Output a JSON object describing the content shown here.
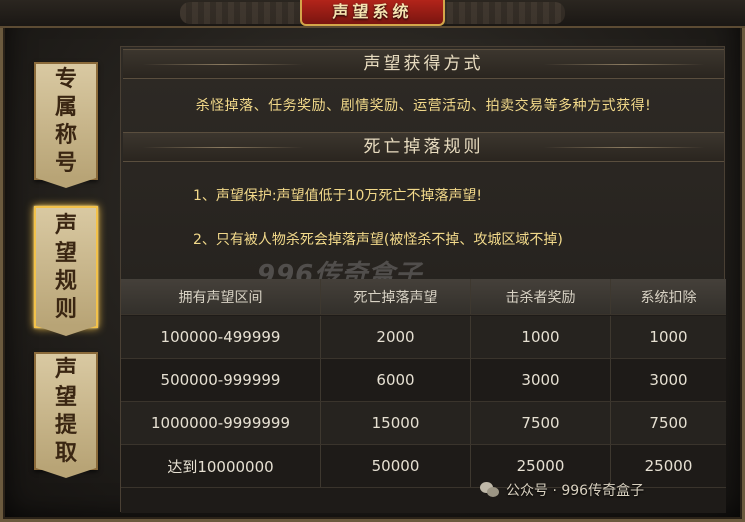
{
  "window": {
    "title": "声望系统"
  },
  "tabs": [
    {
      "label": "专属称号",
      "lines": [
        "专",
        "属",
        "称",
        "号"
      ],
      "active": false
    },
    {
      "label": "声望规则",
      "lines": [
        "声",
        "望",
        "规",
        "则"
      ],
      "active": true
    },
    {
      "label": "声望提取",
      "lines": [
        "声",
        "望",
        "提",
        "取"
      ],
      "active": false
    }
  ],
  "methods": {
    "header": "声望获得方式",
    "text": "杀怪掉落、任务奖励、剧情奖励、运营活动、拍卖交易等多种方式获得!"
  },
  "rules": {
    "header": "死亡掉落规则",
    "items": [
      "1、声望保护:声望值低于10万死亡不掉落声望!",
      "2、只有被人物杀死会掉落声望(被怪杀不掉、攻城区域不掉)"
    ]
  },
  "watermark": "996传奇盒子",
  "table": {
    "headers": [
      "拥有声望区间",
      "死亡掉落声望",
      "击杀者奖励",
      "系统扣除"
    ],
    "rows": [
      [
        "100000-499999",
        "2000",
        "1000",
        "1000"
      ],
      [
        "500000-999999",
        "6000",
        "3000",
        "3000"
      ],
      [
        "1000000-9999999",
        "15000",
        "7500",
        "7500"
      ],
      [
        "达到10000000",
        "50000",
        "25000",
        "25000"
      ]
    ]
  },
  "footer": {
    "text": "公众号 · 996传奇盒子",
    "icon": "wechat-icon"
  },
  "colors": {
    "accent": "#f2d98a",
    "title_bg": "#b2241a",
    "active_glow": "#f3c24a"
  }
}
